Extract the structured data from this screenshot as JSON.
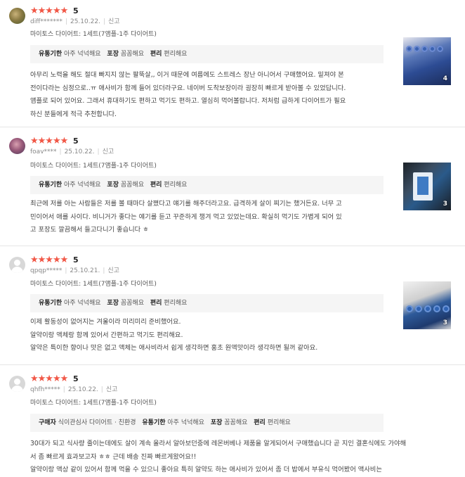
{
  "reviews": [
    {
      "stars": "★★★★★",
      "rating": "5",
      "user": "diff*******",
      "date": "25.10.22.",
      "report": "신고",
      "option": "마이토스 다이어트: 1세트(7앰플-1주 다이어트)",
      "tags": [
        {
          "key": "유통기한",
          "value": "아주 넉넉해요"
        },
        {
          "key": "포장",
          "value": "꼼꼼해요"
        },
        {
          "key": "편리",
          "value": "편리해요"
        }
      ],
      "lines": [
        "아무리 노력을 해도 절대 빠지지 않는 팔뚝살,, 이거 때문에 여름에도 스트레스 장난 아니어서 구매했어요. 밑져야 본",
        "전이다라는 심정으로..ㅠ 애사비가 함께 들어 있더라구요. 네이버 도착보장이라 굉장히 빠르게 받아볼 수 있었답니다.",
        "앰플로 되어 있어요. 그래서 휴대하기도 편하고 먹기도 편하고. 열심히 먹어볼랍니다. 저처럼 급하게 다이어트가 필요",
        "하신 분들에게 적극 추천합니다."
      ],
      "photo_count": "4",
      "avatar": "photo-avatar"
    },
    {
      "stars": "★★★★★",
      "rating": "5",
      "user": "foav****",
      "date": "25.10.22.",
      "report": "신고",
      "option": "마이토스 다이어트: 1세트(7앰플-1주 다이어트)",
      "tags": [
        {
          "key": "유통기한",
          "value": "아주 넉넉해요"
        },
        {
          "key": "포장",
          "value": "꼼꼼해요"
        },
        {
          "key": "편리",
          "value": "편리해요"
        }
      ],
      "lines": [
        "최근에 저를 아는 사람들은 저를 볼 때마다 살쪘다고 얘기를 해주더라고요. 급격하게 살이 찌기는 했거든요. 너무 고",
        "민이어서 애를 사이다. 비니거가 좋다는 얘기를 듣고 꾸준하게 챙겨 먹고 있었는데요. 확실히 먹기도 가볍게 되어 있",
        "고 포장도 깔끔해서 들고다니기 좋습니다 ㅎ"
      ],
      "photo_count": "3",
      "avatar": "photo-avatar"
    },
    {
      "stars": "★★★★★",
      "rating": "5",
      "user": "qpqp*****",
      "date": "25.10.21.",
      "report": "신고",
      "option": "마이토스 다이어트: 1세트(7앰플-1주 다이어트)",
      "tags": [
        {
          "key": "유통기한",
          "value": "아주 넉넉해요"
        },
        {
          "key": "포장",
          "value": "꼼꼼해요"
        },
        {
          "key": "편리",
          "value": "편리해요"
        }
      ],
      "lines": [
        "이제 활동성이 없어지는 겨울이라 미리미리 준비했어요.",
        "알약이랑 액체랑 함께 있어서 간편하고 먹기도 편리해요.",
        "알약은 특이한 향이나 맛은 없고 액체는 애사비라서 쉽게 생각하면 홍초 원액맛이라 생각하면 될꺼 같아요."
      ],
      "photo_count": "3",
      "avatar": "default-avatar"
    },
    {
      "stars": "★★★★★",
      "rating": "5",
      "user": "qhfh*****",
      "date": "25.10.22.",
      "report": "신고",
      "option": "마이토스 다이어트: 1세트(7앰플-1주 다이어트)",
      "tags": [
        {
          "key": "구매자",
          "value": "식이관심사 다이어트 · 친환경"
        },
        {
          "key": "유통기한",
          "value": "아주 넉넉해요"
        },
        {
          "key": "포장",
          "value": "꼼꼼해요"
        },
        {
          "key": "편리",
          "value": "편리해요"
        }
      ],
      "lines": [
        "30대가 되고 식사량 줄이는데에도 살이 계속 올라서 알아보던중에 레몬버베나 제품을 알게되어서 구매했습니다 곧 지인 결혼식에도 가야해",
        "서 좀 빠르게 효과보고자 ㅎㅎ 근데 배송 진짜 빠르게왔어요!!",
        "알약이랑 액상 같이 있어서 함께 먹을 수 있으니 좋아요 특히 알약도 하는 애사비가 있어서 좀 더 밥에서 부유식 먹어봤어 액사비는"
      ],
      "photo_count": "",
      "avatar": "default-avatar"
    }
  ]
}
